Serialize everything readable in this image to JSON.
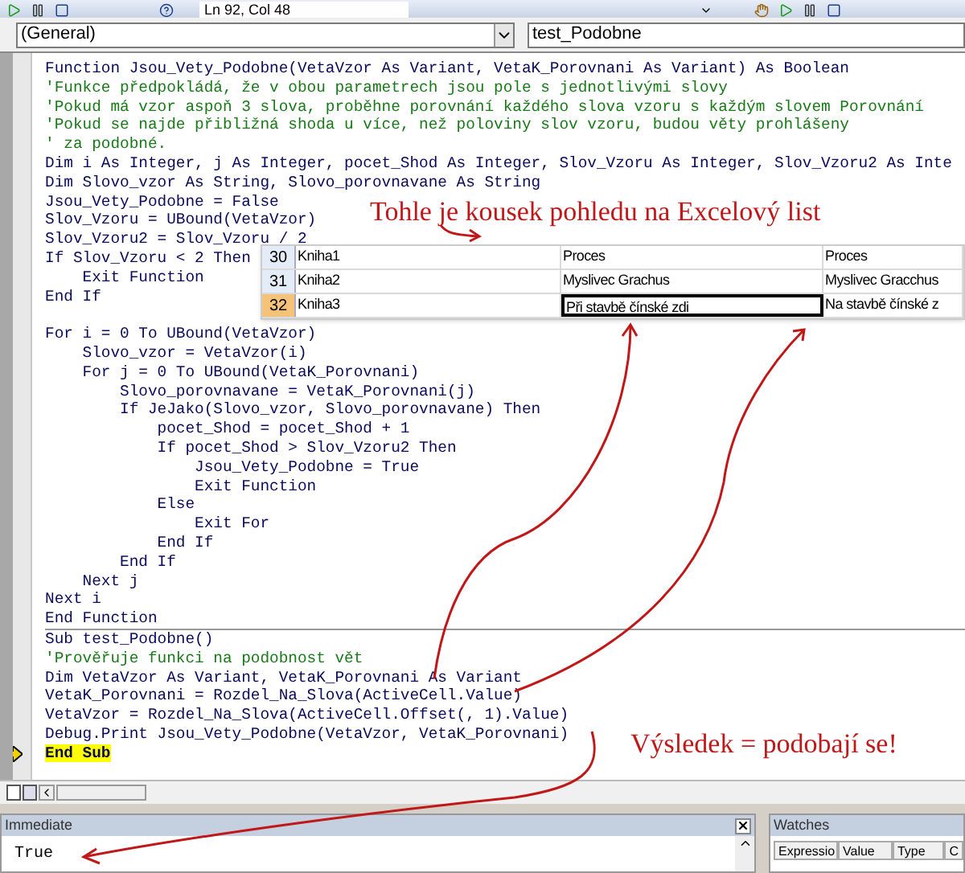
{
  "toolbar": {
    "position": "Ln 92, Col 48"
  },
  "dropdowns": {
    "object": "(General)",
    "procedure": "test_Podobne"
  },
  "code": {
    "procedures": [
      {
        "lines": [
          {
            "text": "Function Jsou_Vety_Podobne(VetaVzor As Variant, VetaK_Porovnani As Variant) As Boolean",
            "kind": "code",
            "current": false
          },
          {
            "text": "'Funkce předpokládá, že v obou parametrech jsou pole s jednotlivými slovy",
            "kind": "comment",
            "current": false
          },
          {
            "text": "'Pokud má vzor aspoň 3 slova, proběhne porovnání každého slova vzoru s každým slovem Porovnání",
            "kind": "comment",
            "current": false
          },
          {
            "text": "'Pokud se najde přibližná shoda u více, než poloviny slov vzoru, budou věty prohlášeny",
            "kind": "comment",
            "current": false
          },
          {
            "text": "' za podobné.",
            "kind": "comment",
            "current": false
          },
          {
            "text": "Dim i As Integer, j As Integer, pocet_Shod As Integer, Slov_Vzoru As Integer, Slov_Vzoru2 As Inte",
            "kind": "code",
            "current": false
          },
          {
            "text": "Dim Slovo_vzor As String, Slovo_porovnavane As String",
            "kind": "code",
            "current": false
          },
          {
            "text": "Jsou_Vety_Podobne = False",
            "kind": "code",
            "current": false
          },
          {
            "text": "Slov_Vzoru = UBound(VetaVzor)",
            "kind": "code",
            "current": false
          },
          {
            "text": "Slov_Vzoru2 = Slov_Vzoru / 2",
            "kind": "code",
            "current": false
          },
          {
            "text": "If Slov_Vzoru < 2 Then",
            "kind": "code",
            "current": false
          },
          {
            "text": "    Exit Function",
            "kind": "code",
            "current": false
          },
          {
            "text": "End If",
            "kind": "code",
            "current": false
          },
          {
            "kind": "blank",
            "current": false
          },
          {
            "text": "For i = 0 To UBound(VetaVzor)",
            "kind": "code",
            "current": false
          },
          {
            "text": "    Slovo_vzor = VetaVzor(i)",
            "kind": "code",
            "current": false
          },
          {
            "text": "    For j = 0 To UBound(VetaK_Porovnani)",
            "kind": "code",
            "current": false
          },
          {
            "text": "        Slovo_porovnavane = VetaK_Porovnani(j)",
            "kind": "code",
            "current": false
          },
          {
            "text": "        If JeJako(Slovo_vzor, Slovo_porovnavane) Then",
            "kind": "code",
            "current": false
          },
          {
            "text": "            pocet_Shod = pocet_Shod + 1",
            "kind": "code",
            "current": false
          },
          {
            "text": "            If pocet_Shod > Slov_Vzoru2 Then",
            "kind": "code",
            "current": false
          },
          {
            "text": "                Jsou_Vety_Podobne = True",
            "kind": "code",
            "current": false
          },
          {
            "text": "                Exit Function",
            "kind": "code",
            "current": false
          },
          {
            "text": "            Else",
            "kind": "code",
            "current": false
          },
          {
            "text": "                Exit For",
            "kind": "code",
            "current": false
          },
          {
            "text": "            End If",
            "kind": "code",
            "current": false
          },
          {
            "text": "        End If",
            "kind": "code",
            "current": false
          },
          {
            "text": "    Next j",
            "kind": "code",
            "current": false
          },
          {
            "text": "Next i",
            "kind": "code",
            "current": false
          },
          {
            "text": "End Function",
            "kind": "code",
            "current": false
          }
        ]
      },
      {
        "lines": [
          {
            "text": "Sub test_Podobne()",
            "kind": "code",
            "current": false
          },
          {
            "text": "'Prověřuje funkci na podobnost vět",
            "kind": "comment",
            "current": false
          },
          {
            "text": "Dim VetaVzor As Variant, VetaK_Porovnani As Variant",
            "kind": "code",
            "current": false
          },
          {
            "text": "VetaK_Porovnani = Rozdel_Na_Slova(ActiveCell.Value)",
            "kind": "code",
            "current": false
          },
          {
            "text": "VetaVzor = Rozdel_Na_Slova(ActiveCell.Offset(, 1).Value)",
            "kind": "code",
            "current": false
          },
          {
            "text": "Debug.Print Jsou_Vety_Podobne(VetaVzor, VetaK_Porovnani)",
            "kind": "code",
            "current": false
          },
          {
            "text": "End Sub",
            "kind": "code",
            "current": true
          }
        ]
      }
    ]
  },
  "spreadsheet": {
    "rows": [
      {
        "number": "30",
        "selected": false,
        "cells": [
          {
            "text": "Kniha1",
            "selected": false
          },
          {
            "text": "Proces",
            "selected": false
          },
          {
            "text": "Proces",
            "selected": false
          }
        ]
      },
      {
        "number": "31",
        "selected": false,
        "cells": [
          {
            "text": "Kniha2",
            "selected": false
          },
          {
            "text": "Myslivec Grachus",
            "selected": false
          },
          {
            "text": "Myslivec Gracchus",
            "selected": false
          }
        ]
      },
      {
        "number": "32",
        "selected": true,
        "cells": [
          {
            "text": "Kniha3",
            "selected": false
          },
          {
            "text": "Při stavbě čínské zdi",
            "selected": true
          },
          {
            "text": "Na stavbě čínské z",
            "selected": false
          }
        ]
      }
    ]
  },
  "annotations": {
    "top": "Tohle je kousek pohledu na Excelový list",
    "bottom": "Výsledek = podobají se!"
  },
  "immediate": {
    "title": "Immediate",
    "output": "True"
  },
  "watches": {
    "title": "Watches",
    "columns": [
      "Expressio",
      "Value",
      "Type",
      "C"
    ]
  }
}
